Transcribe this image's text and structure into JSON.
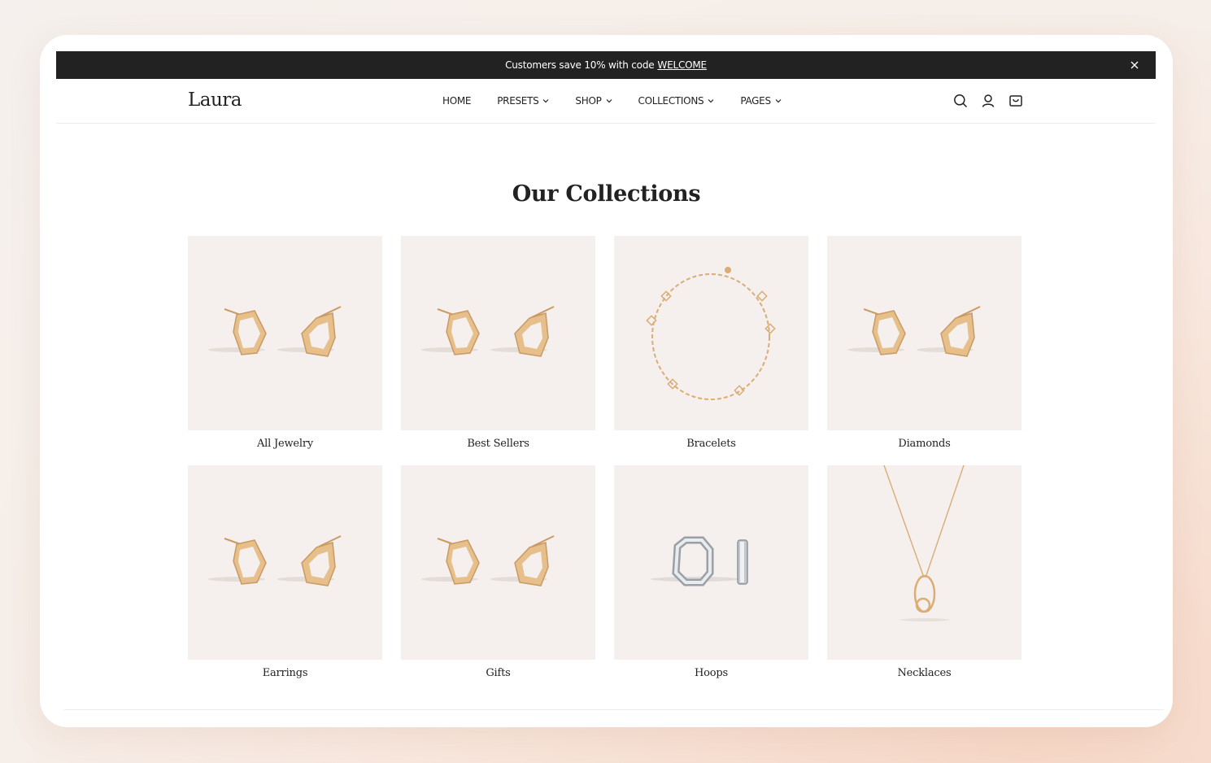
{
  "announcement": {
    "text": "Customers save 10% with code",
    "code": "WELCOME"
  },
  "header": {
    "logo": "Laura",
    "nav": [
      {
        "label": "HOME",
        "dropdown": false
      },
      {
        "label": "PRESETS",
        "dropdown": true
      },
      {
        "label": "SHOP",
        "dropdown": true
      },
      {
        "label": "COLLECTIONS",
        "dropdown": true
      },
      {
        "label": "PAGES",
        "dropdown": true
      }
    ],
    "icons": [
      "search-icon",
      "account-icon",
      "cart-icon"
    ]
  },
  "main": {
    "title": "Our Collections",
    "collections": [
      {
        "label": "All Jewelry",
        "image": "earrings"
      },
      {
        "label": "Best Sellers",
        "image": "earrings"
      },
      {
        "label": "Bracelets",
        "image": "bracelet"
      },
      {
        "label": "Diamonds",
        "image": "earrings"
      },
      {
        "label": "Earrings",
        "image": "earrings"
      },
      {
        "label": "Gifts",
        "image": "earrings"
      },
      {
        "label": "Hoops",
        "image": "hoops"
      },
      {
        "label": "Necklaces",
        "image": "necklace"
      }
    ]
  },
  "colors": {
    "announcement_bg": "#222222",
    "card_bg": "#f5f0ee",
    "gold": "#d4a46a"
  }
}
